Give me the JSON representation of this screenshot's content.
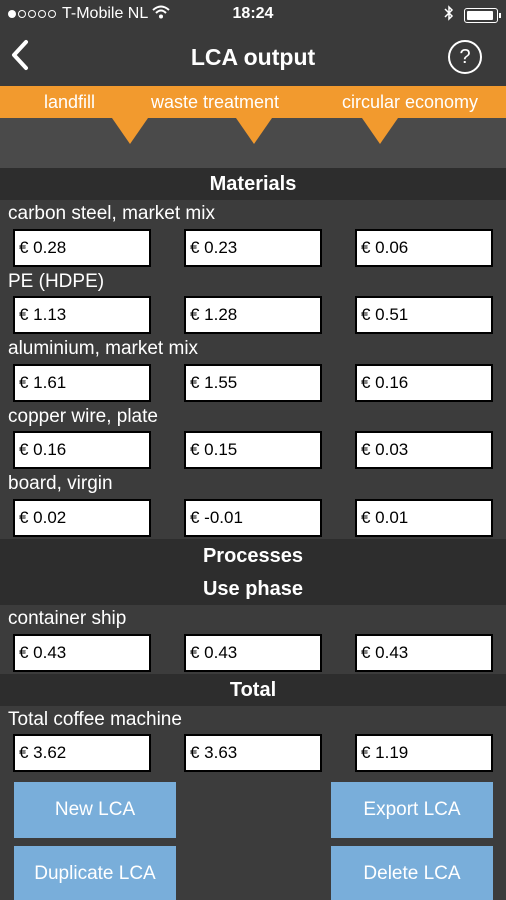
{
  "status": {
    "carrier": "T-Mobile NL",
    "time": "18:24",
    "signal_full": 1,
    "signal_total": 5
  },
  "nav": {
    "title": "LCA output",
    "back_icon": "chevron-left-icon",
    "help_icon": "question-circle-icon"
  },
  "tabs": [
    "landfill",
    "waste treatment",
    "circular economy"
  ],
  "sections": {
    "materials": "Materials",
    "processes": "Processes",
    "use_phase": "Use phase",
    "total": "Total"
  },
  "materials": [
    {
      "label": "carbon steel, market mix",
      "values": [
        "€ 0.28",
        "€ 0.23",
        "€ 0.06"
      ]
    },
    {
      "label": "PE (HDPE)",
      "values": [
        "€ 1.13",
        "€ 1.28",
        "€ 0.51"
      ]
    },
    {
      "label": "aluminium, market mix",
      "values": [
        "€ 1.61",
        "€ 1.55",
        "€ 0.16"
      ]
    },
    {
      "label": "copper wire, plate",
      "values": [
        "€ 0.16",
        "€ 0.15",
        "€ 0.03"
      ]
    },
    {
      "label": "board, virgin",
      "values": [
        "€ 0.02",
        "€ -0.01",
        "€ 0.01"
      ]
    }
  ],
  "use_phase": [
    {
      "label": "container ship",
      "values": [
        "€ 0.43",
        "€ 0.43",
        "€ 0.43"
      ]
    }
  ],
  "total": {
    "label": "Total coffee machine",
    "values": [
      "€ 3.62",
      "€ 3.63",
      "€ 1.19"
    ]
  },
  "buttons": {
    "new": "New LCA",
    "export": "Export LCA",
    "duplicate": "Duplicate LCA",
    "delete": "Delete LCA"
  },
  "colors": {
    "accent": "#f29a2e",
    "button": "#79aeda",
    "section_bg": "#2d2d2d"
  }
}
